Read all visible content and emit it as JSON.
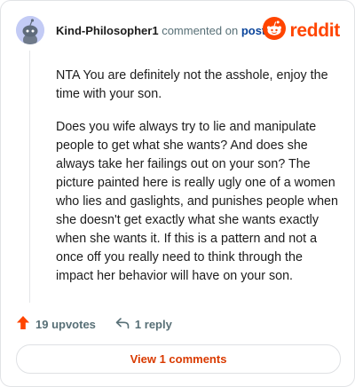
{
  "header": {
    "username": "Kind-Philosopher1",
    "action_text": "commented on",
    "post_link": "post",
    "logo_text": "reddit",
    "avatar_icon": "snoo-avatar-icon",
    "logo_icon": "reddit-snoo-icon"
  },
  "comment": {
    "paragraphs": [
      "NTA You are definitely not the asshole, enjoy the time with your son.",
      "Does you wife always try to lie and manipulate people to get what she wants? And does she always take her failings out on your son? The picture painted here is really ugly one of a women who lies and gaslights, and punishes people when she doesn't get exactly what she wants exactly when she wants it. If this is a pattern and not a once off you really need to think through the impact her behavior will have on your son."
    ]
  },
  "actions": {
    "upvotes": "19 upvotes",
    "replies": "1 reply"
  },
  "footer": {
    "view_comments": "View 1 comments"
  },
  "colors": {
    "brand": "#ff4500",
    "link": "#0a449b",
    "muted": "#576f76",
    "button_text": "#d93a00"
  }
}
